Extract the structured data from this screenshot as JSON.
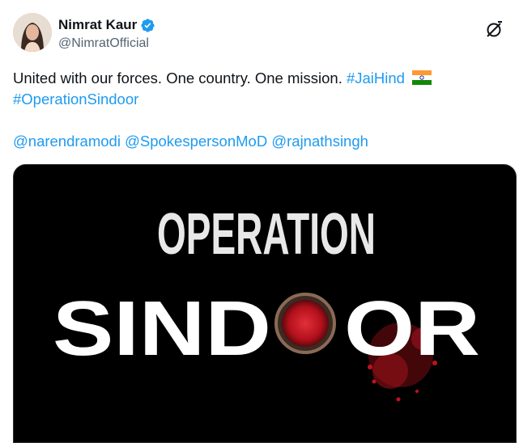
{
  "author": {
    "display_name": "Nimrat Kaur",
    "handle": "@NimratOfficial",
    "verified": true,
    "verified_color": "#1d9bf0"
  },
  "actions": {
    "grok_icon": "grok-icon"
  },
  "tweet": {
    "text_part1": "United with our forces. One country. One mission.",
    "hashtag1": "#JaiHind",
    "flag_emoji": "india-flag-emoji",
    "hashtag2": "#OperationSindoor",
    "mention1": "@narendramodi",
    "mention2": "@SpokespersonMoD",
    "mention3": "@rajnathsingh"
  },
  "media": {
    "title_line1": "OPERATION",
    "title_line2_left": "SIND",
    "title_line2_right": "OR",
    "background": "#000000",
    "accent": "#c0121f"
  },
  "colors": {
    "link": "#1d9bf0",
    "text": "#0f1419",
    "secondary": "#536471"
  }
}
